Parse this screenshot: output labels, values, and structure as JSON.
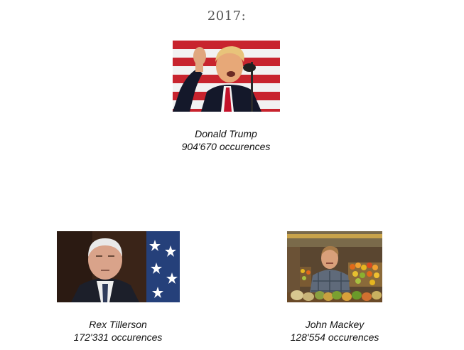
{
  "year_heading": "2017:",
  "people": [
    {
      "name": "Donald Trump",
      "occurrences": "904'670 occurences",
      "photo_icon": "portrait-photo-trump"
    },
    {
      "name": "Rex Tillerson",
      "occurrences": "172'331 occurences",
      "photo_icon": "portrait-photo-tillerson"
    },
    {
      "name": "John Mackey",
      "occurrences": "128'554 occurences",
      "photo_icon": "portrait-photo-mackey"
    }
  ]
}
